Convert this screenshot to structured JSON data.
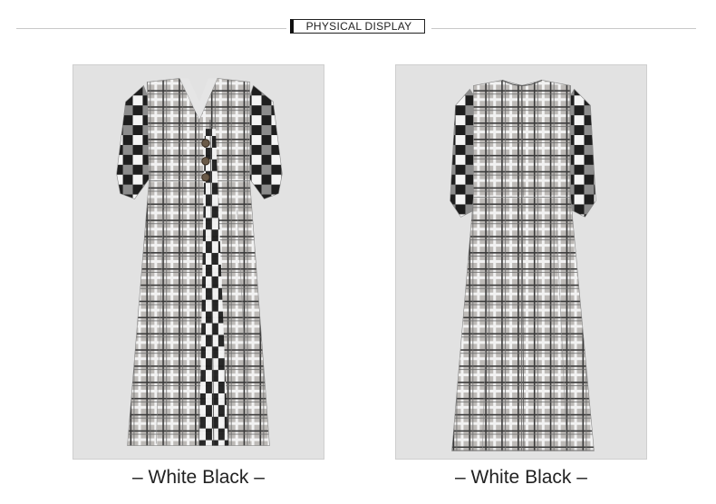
{
  "header": {
    "title": "PHYSICAL DISPLAY"
  },
  "photos": [
    {
      "view": "front",
      "caption": "– White Black –"
    },
    {
      "view": "back",
      "caption": "– White Black –"
    }
  ],
  "colors": {
    "panel_background": "#e2e2e2",
    "plaid_base": "#b9b6b3",
    "check_dark": "#1e1e1e",
    "check_light": "#f4f4f4"
  }
}
